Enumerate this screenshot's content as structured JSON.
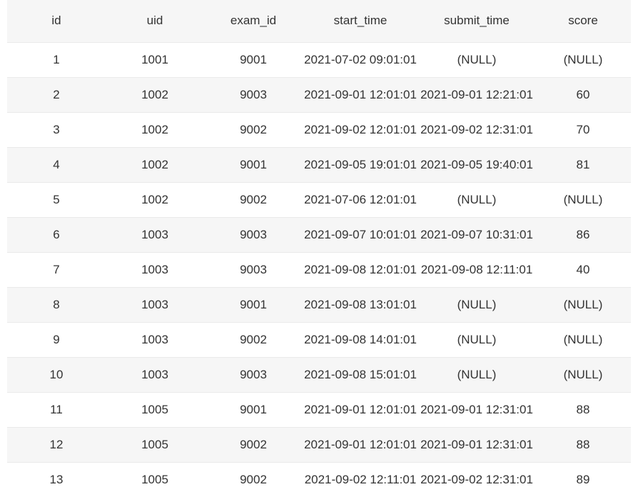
{
  "table": {
    "columns": [
      "id",
      "uid",
      "exam_id",
      "start_time",
      "submit_time",
      "score"
    ],
    "rows": [
      [
        "1",
        "1001",
        "9001",
        "2021-07-02 09:01:01",
        "(NULL)",
        "(NULL)"
      ],
      [
        "2",
        "1002",
        "9003",
        "2021-09-01 12:01:01",
        "2021-09-01 12:21:01",
        "60"
      ],
      [
        "3",
        "1002",
        "9002",
        "2021-09-02 12:01:01",
        "2021-09-02 12:31:01",
        "70"
      ],
      [
        "4",
        "1002",
        "9001",
        "2021-09-05 19:01:01",
        "2021-09-05 19:40:01",
        "81"
      ],
      [
        "5",
        "1002",
        "9002",
        "2021-07-06 12:01:01",
        "(NULL)",
        "(NULL)"
      ],
      [
        "6",
        "1003",
        "9003",
        "2021-09-07 10:01:01",
        "2021-09-07 10:31:01",
        "86"
      ],
      [
        "7",
        "1003",
        "9003",
        "2021-09-08 12:01:01",
        "2021-09-08 12:11:01",
        "40"
      ],
      [
        "8",
        "1003",
        "9001",
        "2021-09-08 13:01:01",
        "(NULL)",
        "(NULL)"
      ],
      [
        "9",
        "1003",
        "9002",
        "2021-09-08 14:01:01",
        "(NULL)",
        "(NULL)"
      ],
      [
        "10",
        "1003",
        "9003",
        "2021-09-08 15:01:01",
        "(NULL)",
        "(NULL)"
      ],
      [
        "11",
        "1005",
        "9001",
        "2021-09-01 12:01:01",
        "2021-09-01 12:31:01",
        "88"
      ],
      [
        "12",
        "1005",
        "9002",
        "2021-09-01 12:01:01",
        "2021-09-01 12:31:01",
        "88"
      ],
      [
        "13",
        "1005",
        "9002",
        "2021-09-02 12:11:01",
        "2021-09-02 12:31:01",
        "89"
      ]
    ]
  }
}
